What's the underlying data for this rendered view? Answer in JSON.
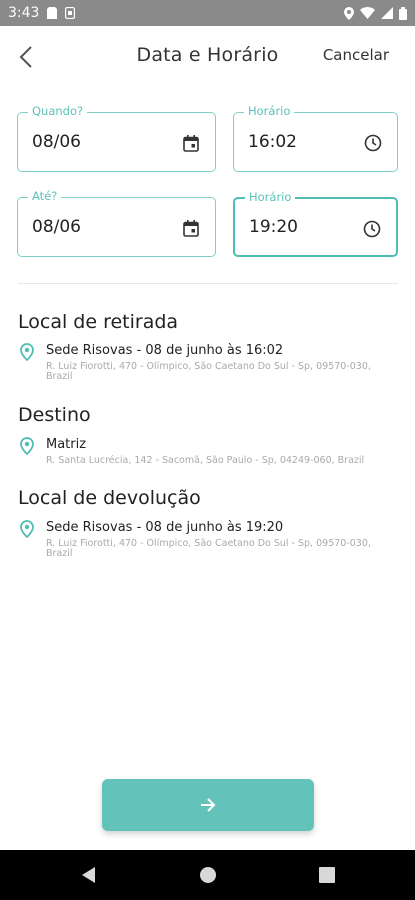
{
  "status_bar": {
    "time": "3:43",
    "left_icons": [
      "sd-card-icon",
      "sim-icon"
    ],
    "right_icons": [
      "location-icon",
      "wifi-icon",
      "signal-icon",
      "battery-icon"
    ]
  },
  "header": {
    "title": "Data e Horário",
    "cancel_label": "Cancelar",
    "back_icon": "chevron-left-icon"
  },
  "form": {
    "start_date": {
      "label": "Quando?",
      "value": "08/06",
      "icon": "calendar-icon"
    },
    "start_time": {
      "label": "Horário",
      "value": "16:02",
      "icon": "clock-icon"
    },
    "end_date": {
      "label": "Até?",
      "value": "08/06",
      "icon": "calendar-icon"
    },
    "end_time": {
      "label": "Horário",
      "value": "19:20",
      "icon": "clock-icon",
      "focused": true
    }
  },
  "sections": {
    "pickup": {
      "title": "Local de retirada",
      "name": "Sede Risovas - 08 de junho às 16:02",
      "address": "R. Luiz Fiorotti, 470 - Olímpico, São Caetano Do Sul - Sp, 09570-030, Brazil"
    },
    "destination": {
      "title": "Destino",
      "name": "Matriz",
      "address": "R. Santa Lucrécia, 142 - Sacomã, São Paulo - Sp, 04249-060, Brazil"
    },
    "return": {
      "title": "Local de devolução",
      "name": "Sede Risovas - 08 de junho às 19:20",
      "address": "R. Luiz Fiorotti, 470 - Olímpico, São Caetano Do Sul - Sp, 09570-030, Brazil"
    }
  },
  "next_button": {
    "icon": "arrow-right-icon"
  },
  "nav_bar": {
    "items": [
      "back-icon",
      "home-icon",
      "recents-icon"
    ]
  },
  "colors": {
    "accent": "#63c3ba",
    "field_border": "#7fcfc6",
    "label": "#5cc1b7",
    "status_bar": "#8a8a8a"
  }
}
